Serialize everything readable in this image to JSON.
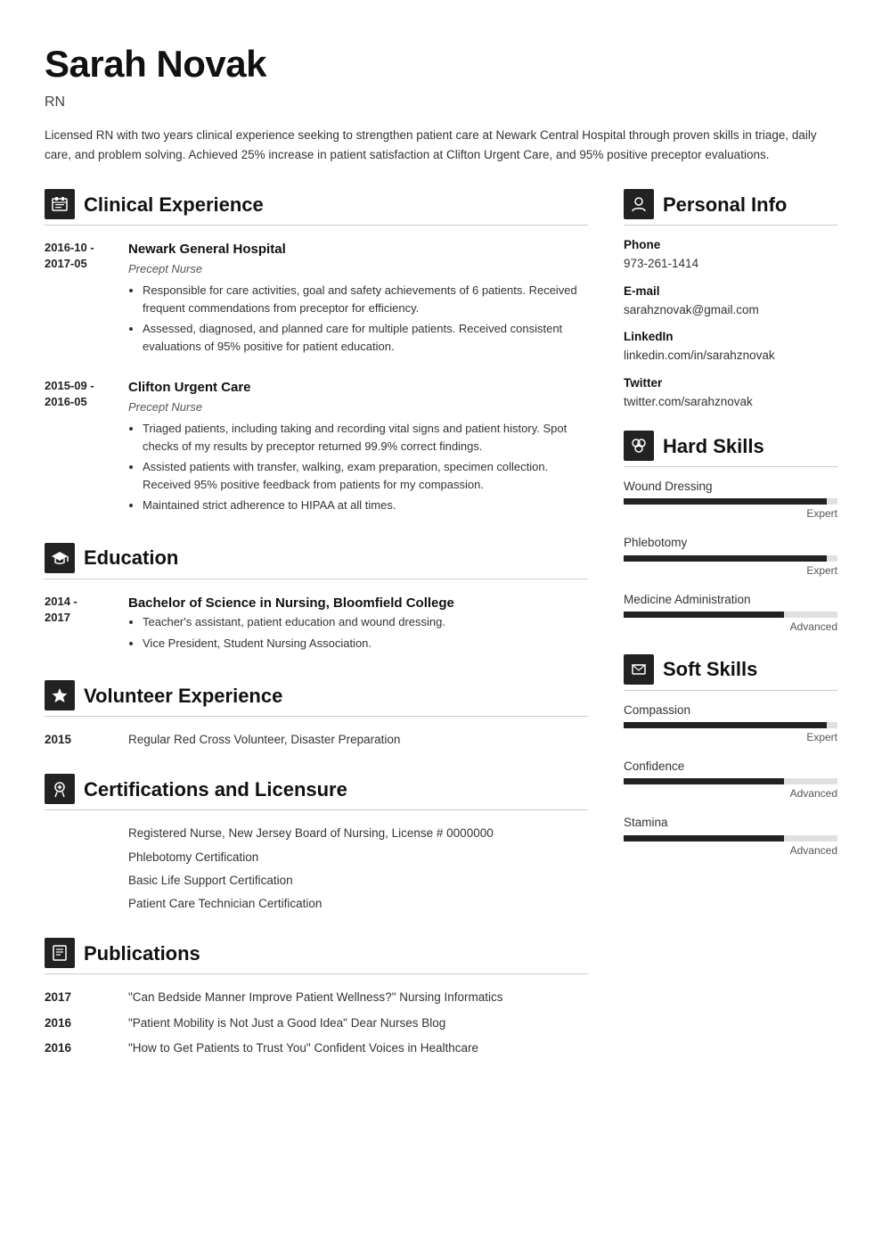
{
  "header": {
    "name": "Sarah Novak",
    "title": "RN",
    "summary": "Licensed RN with two years clinical experience seeking to strengthen patient care at Newark Central Hospital through proven skills in triage, daily care, and problem solving. Achieved 25% increase in patient satisfaction at Clifton Urgent Care, and 95% positive preceptor evaluations."
  },
  "sections": {
    "clinical_experience": {
      "label": "Clinical Experience",
      "icon": "🗂",
      "entries": [
        {
          "date_start": "2016-10 -",
          "date_end": "2017-05",
          "employer": "Newark General Hospital",
          "role": "Precept Nurse",
          "bullets": [
            "Responsible for care activities, goal and safety achievements of 6 patients. Received frequent commendations from preceptor for efficiency.",
            "Assessed, diagnosed, and planned care for multiple patients. Received consistent evaluations of 95% positive for patient education."
          ]
        },
        {
          "date_start": "2015-09 -",
          "date_end": "2016-05",
          "employer": "Clifton Urgent Care",
          "role": "Precept Nurse",
          "bullets": [
            "Triaged patients, including taking and recording vital signs and patient history. Spot checks of my results by preceptor returned 99.9% correct findings.",
            "Assisted patients with transfer, walking, exam preparation, specimen collection. Received 95% positive feedback from patients for my compassion.",
            "Maintained strict adherence to HIPAA at all times."
          ]
        }
      ]
    },
    "education": {
      "label": "Education",
      "icon": "🎓",
      "entries": [
        {
          "date_start": "2014 -",
          "date_end": "2017",
          "degree": "Bachelor of Science in Nursing, Bloomfield College",
          "bullets": [
            "Teacher's assistant, patient education and wound dressing.",
            "Vice President, Student Nursing Association."
          ]
        }
      ]
    },
    "volunteer": {
      "label": "Volunteer Experience",
      "icon": "⭐",
      "entries": [
        {
          "year": "2015",
          "desc": "Regular Red Cross Volunteer, Disaster Preparation"
        }
      ]
    },
    "certifications": {
      "label": "Certifications and Licensure",
      "icon": "🔑",
      "items": [
        "Registered Nurse, New Jersey Board of Nursing, License # 0000000",
        "Phlebotomy Certification",
        "Basic Life Support Certification",
        "Patient Care Technician Certification"
      ]
    },
    "publications": {
      "label": "Publications",
      "icon": "📋",
      "entries": [
        {
          "year": "2017",
          "desc": "\"Can Bedside Manner Improve Patient Wellness?\" Nursing Informatics"
        },
        {
          "year": "2016",
          "desc": "\"Patient Mobility is Not Just a Good Idea\" Dear Nurses Blog"
        },
        {
          "year": "2016",
          "desc": "\"How to Get Patients to Trust You\" Confident Voices in Healthcare"
        }
      ]
    }
  },
  "sidebar": {
    "personal_info": {
      "label": "Personal Info",
      "icon": "👤",
      "items": [
        {
          "label": "Phone",
          "value": "973-261-1414"
        },
        {
          "label": "E-mail",
          "value": "sarahznovak@gmail.com"
        },
        {
          "label": "LinkedIn",
          "value": "linkedin.com/in/sarahznovak"
        },
        {
          "label": "Twitter",
          "value": "twitter.com/sarahznovak"
        }
      ]
    },
    "hard_skills": {
      "label": "Hard Skills",
      "icon": "🔧",
      "items": [
        {
          "name": "Wound Dressing",
          "level_label": "Expert",
          "percent": 95
        },
        {
          "name": "Phlebotomy",
          "level_label": "Expert",
          "percent": 95
        },
        {
          "name": "Medicine Administration",
          "level_label": "Advanced",
          "percent": 75
        }
      ]
    },
    "soft_skills": {
      "label": "Soft Skills",
      "icon": "🚩",
      "items": [
        {
          "name": "Compassion",
          "level_label": "Expert",
          "percent": 95
        },
        {
          "name": "Confidence",
          "level_label": "Advanced",
          "percent": 75
        },
        {
          "name": "Stamina",
          "level_label": "Advanced",
          "percent": 75
        }
      ]
    }
  }
}
